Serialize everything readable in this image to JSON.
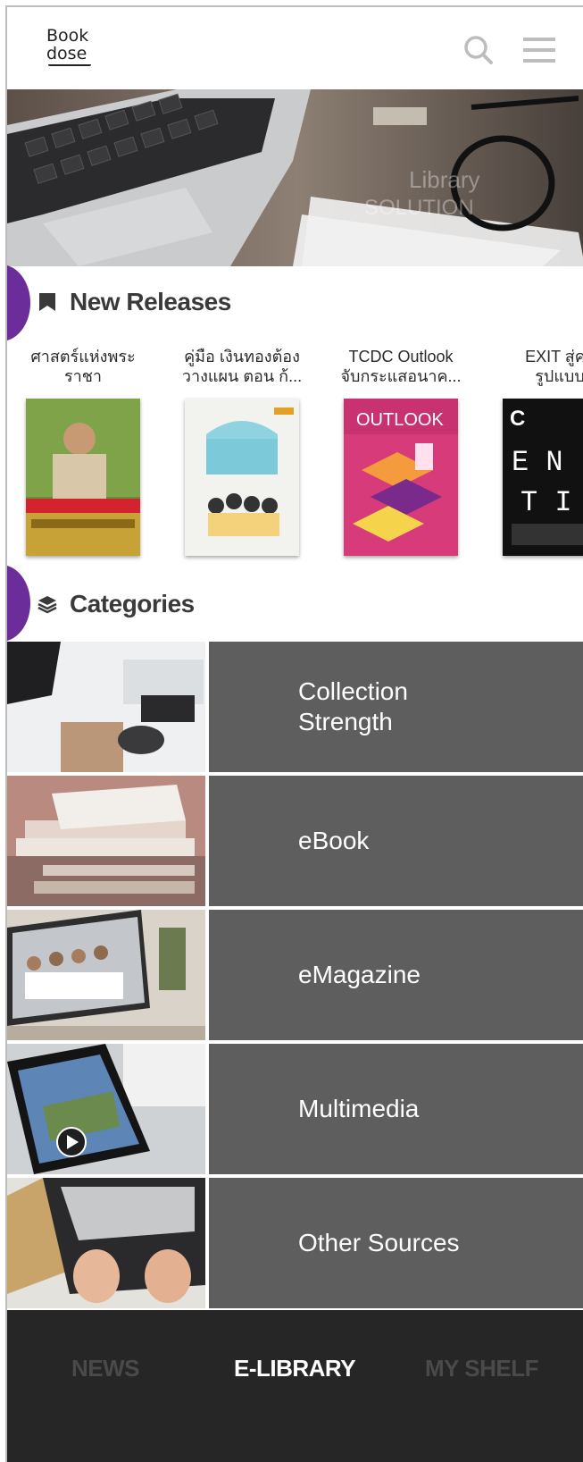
{
  "header": {
    "logo_line1": "Book",
    "logo_line2": "dose",
    "icons": [
      "search-icon",
      "hamburger-menu-icon"
    ]
  },
  "hero": {
    "image": "laptop-keyboard-glasses-desk-photo",
    "watermark_line1": "Library",
    "watermark_line2": "SOLUTION"
  },
  "new_releases": {
    "title": "New Releases",
    "icon": "bookmark-icon",
    "books": [
      {
        "title": "ศาสตร์แห่งพระ\nราชา",
        "cover": "king-portrait-cover"
      },
      {
        "title": "คู่มือ เงินทองต้อง\nวางแผน ตอน ก้...",
        "cover": "money-planning-cover"
      },
      {
        "title": "TCDC Outlook\nจับกระแสอนาค...",
        "cover": "tcdc-outlook-cover"
      },
      {
        "title": "EXIT สู่คว\nรูปแบบ",
        "cover": "exit-cover"
      }
    ]
  },
  "categories": {
    "title": "Categories",
    "icon": "layers-icon",
    "items": [
      {
        "label": "Collection\nStrength",
        "image": "desk-workspace-photo"
      },
      {
        "label": "eBook",
        "image": "book-stack-photo"
      },
      {
        "label": "eMagazine",
        "image": "laptop-people-photo"
      },
      {
        "label": "Multimedia",
        "image": "phone-video-photo"
      },
      {
        "label": "Other Sources",
        "image": "typing-laptop-photo"
      }
    ]
  },
  "bottom_nav": {
    "items": [
      {
        "label": "NEWS",
        "active": false
      },
      {
        "label": "E-LIBRARY",
        "active": true
      },
      {
        "label": "MY SHELF",
        "active": false
      }
    ]
  },
  "colors": {
    "accent_purple": "#6b2d9a",
    "category_bg": "#5e5e5e",
    "nav_bg": "#262626"
  }
}
